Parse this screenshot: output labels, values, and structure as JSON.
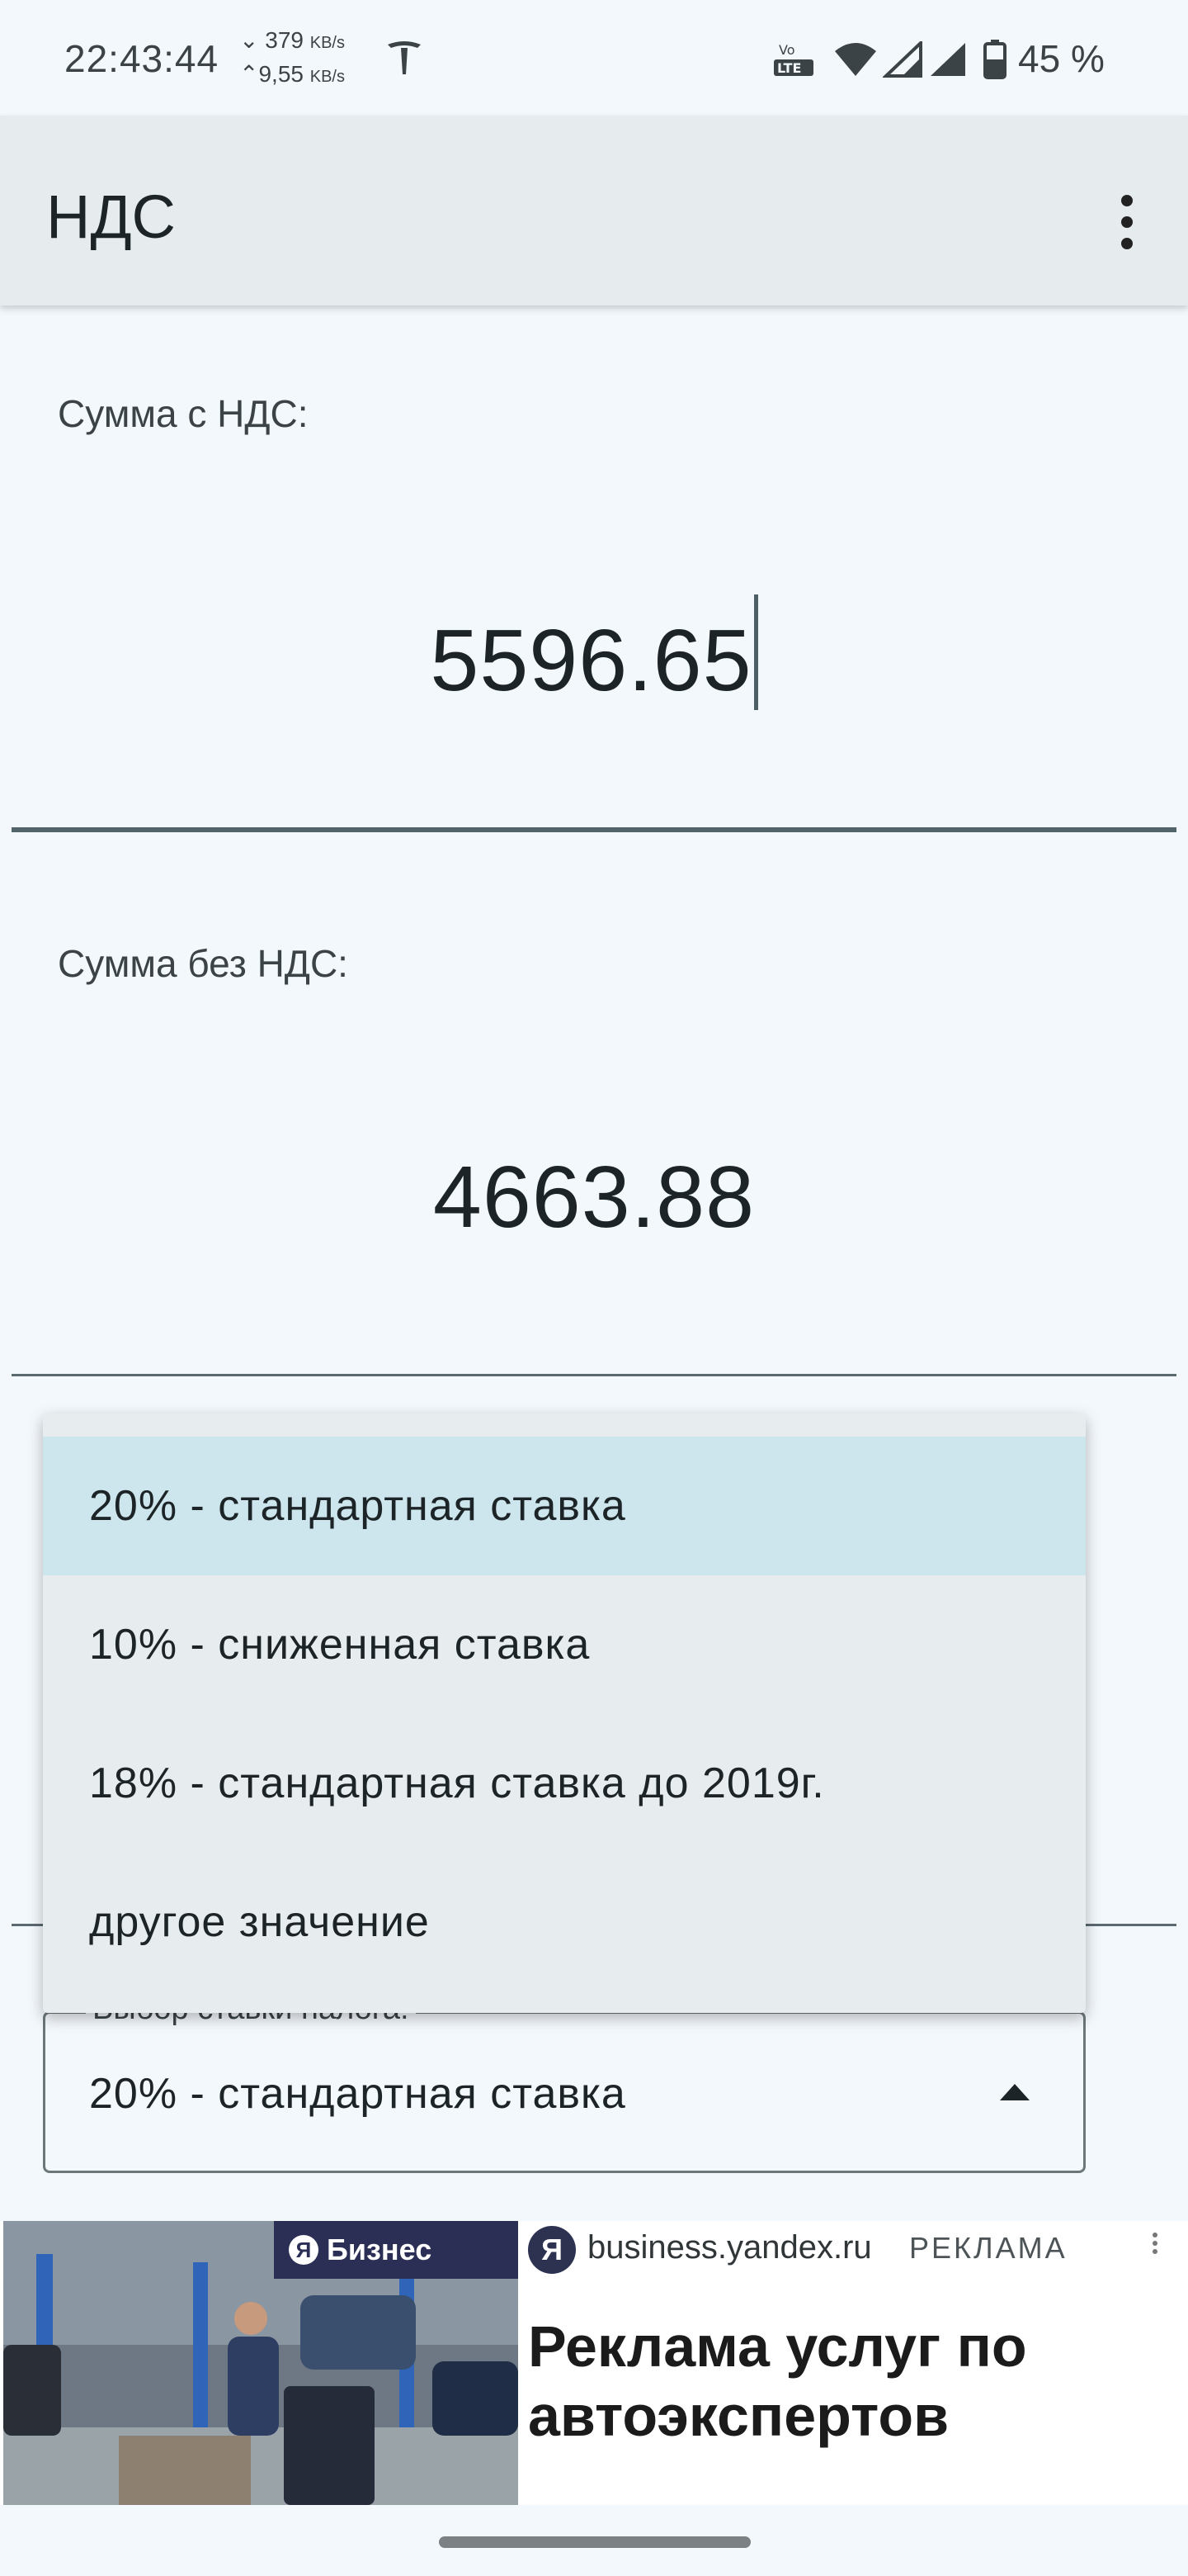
{
  "status_bar": {
    "time": "22:43:44",
    "speed_down": "379",
    "speed_down_unit": "KB/s",
    "speed_up": "9,55",
    "speed_up_unit": "KB/s",
    "lte_label_top": "Vo",
    "lte_label_bottom": "LTE",
    "battery": "45 %"
  },
  "app_bar": {
    "title": "НДС"
  },
  "form": {
    "with_vat_label": "Сумма с НДС:",
    "with_vat_value": "5596.65",
    "without_vat_label": "Сумма без НДС:",
    "without_vat_value": "4663.88",
    "rate_label": "Выбор ставки налога:",
    "rate_selected": "20% - стандартная ставка"
  },
  "rate_menu": {
    "options": [
      "20% - стандартная ставка",
      "10% - сниженная ставка",
      "18% - стандартная ставка до 2019г.",
      "другое значение"
    ],
    "selected_index": 0
  },
  "ad": {
    "badge_letter": "Я",
    "badge_text": "Бизнес",
    "icon_letter": "Я",
    "domain": "business.yandex.ru",
    "tag": "РЕКЛАМА",
    "headline": "Реклама услуг по автоэкспертов"
  },
  "colors": {
    "background": "#f3f8fc",
    "app_bar": "#e6ebee",
    "menu_bg": "#e7ecee",
    "menu_selected": "#cde5ec",
    "accent_underline": "#51646a"
  },
  "icons": [
    "tesla-icon",
    "volte-icon",
    "wifi-icon",
    "signal-icon",
    "signal-icon",
    "battery-icon",
    "more-vert-icon",
    "dropdown-arrow-icon"
  ]
}
